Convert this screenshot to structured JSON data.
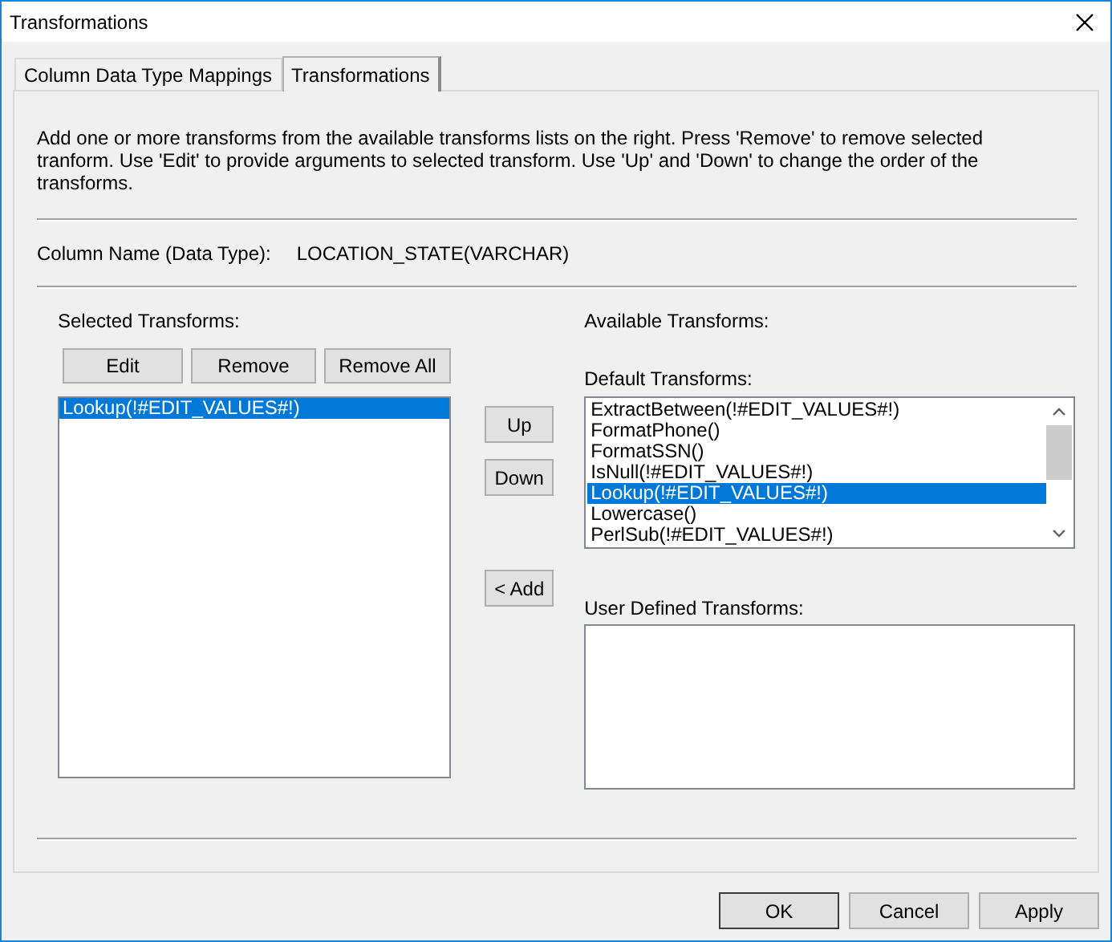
{
  "window": {
    "title": "Transformations"
  },
  "tabs": [
    {
      "label": "Column Data Type Mappings",
      "selected": false
    },
    {
      "label": "Transformations",
      "selected": true
    }
  ],
  "instructions": "Add one or more transforms from the available transforms lists on the right. Press 'Remove' to remove selected tranform. Use 'Edit' to provide arguments to selected transform. Use 'Up' and 'Down' to change the order of the transforms.",
  "column_name": {
    "label": "Column Name (Data Type):",
    "value": "LOCATION_STATE(VARCHAR)"
  },
  "selected_transforms": {
    "label": "Selected Transforms:",
    "buttons": [
      "Edit",
      "Remove",
      "Remove All"
    ],
    "items": [
      {
        "label": "Lookup(!#EDIT_VALUES#!)",
        "selected": true
      }
    ]
  },
  "order_buttons": [
    "Up",
    "Down"
  ],
  "add_button": "< Add",
  "available_transforms": {
    "label": "Available Transforms:",
    "default_label": "Default Transforms:",
    "default_items": [
      {
        "label": "ExtractBetween(!#EDIT_VALUES#!)",
        "selected": false
      },
      {
        "label": "FormatPhone()",
        "selected": false
      },
      {
        "label": "FormatSSN()",
        "selected": false
      },
      {
        "label": "IsNull(!#EDIT_VALUES#!)",
        "selected": false
      },
      {
        "label": "Lookup(!#EDIT_VALUES#!)",
        "selected": true
      },
      {
        "label": "Lowercase()",
        "selected": false
      },
      {
        "label": "PerlSub(!#EDIT_VALUES#!)",
        "selected": false
      }
    ],
    "user_label": "User Defined Transforms:"
  },
  "buttons": [
    "OK",
    "Cancel",
    "Apply"
  ]
}
